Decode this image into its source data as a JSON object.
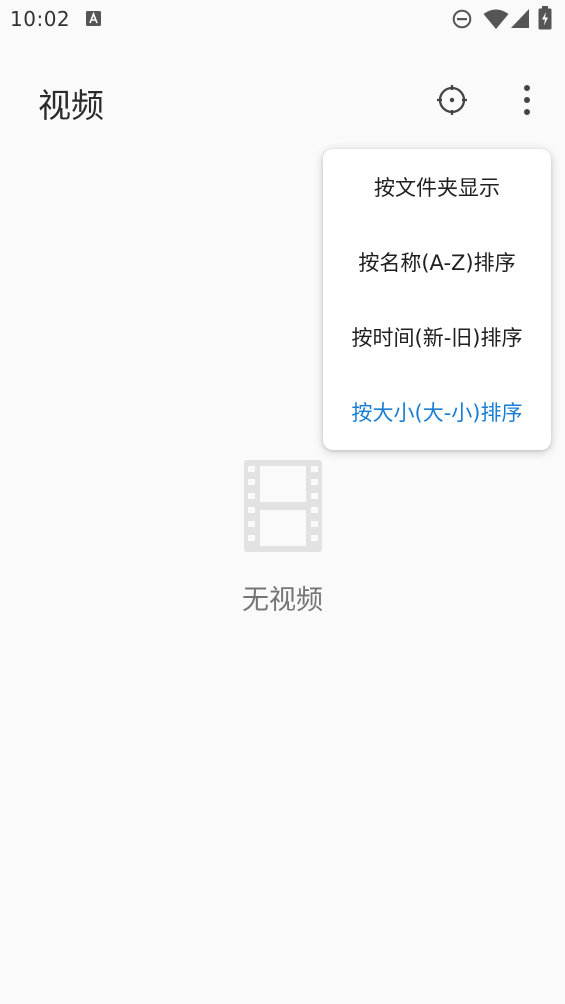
{
  "status_bar": {
    "time": "10:02",
    "notification_icon": "a-letter-icon",
    "icons": [
      "do-not-disturb-icon",
      "wifi-icon",
      "cell-signal-icon",
      "battery-charging-icon"
    ]
  },
  "app_bar": {
    "title": "视频",
    "actions": [
      "locate-target-icon",
      "more-vert-icon"
    ]
  },
  "empty_state": {
    "icon": "film-strip-icon",
    "text": "无视频"
  },
  "menu": {
    "items": [
      {
        "label": "按文件夹显示",
        "active": false
      },
      {
        "label": "按名称(A-Z)排序",
        "active": false
      },
      {
        "label": "按时间(新-旧)排序",
        "active": false
      },
      {
        "label": "按大小(大-小)排序",
        "active": true
      }
    ],
    "active_color": "#1a7fd4"
  },
  "colors": {
    "background": "#fafafa",
    "menu_background": "#ffffff",
    "icon_gray": "#e0e0e0"
  }
}
